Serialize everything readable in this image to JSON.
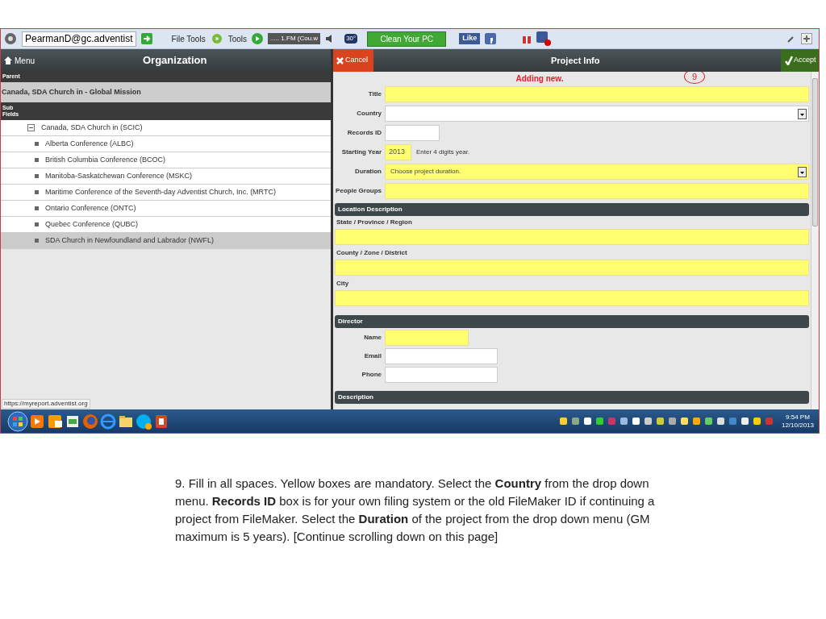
{
  "toolbar": {
    "account": "PearmanD@gc.adventist",
    "file_tools": "File Tools",
    "tools": "Tools",
    "station": "..... 1.FM (Cou.w",
    "weather": "30°",
    "clean_button": "Clean Your PC",
    "like_button": "Like"
  },
  "organization": {
    "menu": "Menu",
    "title": "Organization",
    "parent_label": "Parent",
    "parent": "Canada, SDA Church in - Global Mission",
    "sub_label": "Sub Fields",
    "tree": [
      {
        "label": "Canada, SDA Church in (SCIC)",
        "expanded": true,
        "selected": false,
        "children": [
          {
            "label": "Alberta Conference (ALBC)",
            "selected": false
          },
          {
            "label": "British Columbia Conference (BCOC)",
            "selected": false
          },
          {
            "label": "Manitoba-Saskatchewan Conference (MSKC)",
            "selected": false
          },
          {
            "label": "Maritime Conference of the Seventh-day Adventist Church, Inc. (MRTC)",
            "selected": false
          },
          {
            "label": "Ontario Conference (ONTC)",
            "selected": false
          },
          {
            "label": "Quebec Conference (QUBC)",
            "selected": false
          },
          {
            "label": "SDA Church in Newfoundland and Labrador (NWFL)",
            "selected": true
          }
        ]
      }
    ]
  },
  "project": {
    "cancel": "Cancel",
    "title": "Project Info",
    "accept": "Accept",
    "notice": "Adding new.",
    "annotation": "9",
    "fields": [
      {
        "kind": "text",
        "label": "Title",
        "required": true
      },
      {
        "kind": "select",
        "label": "Country",
        "required": false
      },
      {
        "kind": "short",
        "label": "Records ID",
        "required": false
      },
      {
        "kind": "year",
        "label": "Starting Year",
        "required": true,
        "value": "2013",
        "hint": "Enter 4 digits year."
      },
      {
        "kind": "select",
        "label": "Duration",
        "required": true,
        "value": "Choose project duration."
      },
      {
        "kind": "text",
        "label": "People Groups",
        "required": true
      }
    ],
    "sections": [
      {
        "kind": "stacked",
        "title": "Location Description",
        "fields": [
          {
            "label": "State / Province / Region",
            "required": true
          },
          {
            "label": "County / Zone / District",
            "required": true
          },
          {
            "label": "City",
            "required": true
          }
        ]
      },
      {
        "kind": "inline",
        "title": "Director",
        "fields": [
          {
            "label": "Name",
            "required": true
          },
          {
            "label": "Email",
            "required": false
          },
          {
            "label": "Phone",
            "required": false
          }
        ]
      },
      {
        "kind": "inline",
        "title": "Description"
      }
    ]
  },
  "status_url": "https://myreport.adventist.org",
  "taskbar": {
    "time": "9:54 PM",
    "date": "12/10/2013"
  },
  "caption": "9.  Fill in all spaces.  Yellow boxes are mandatory. Select the **Country** from the drop down menu.  **Records ID** box is for your own filing system or the old FileMaker ID if continuing a project from FileMaker.  Select the **Duration** of the project from the drop down menu (GM maximum is 5 years).  [Continue scrolling down on this page]"
}
